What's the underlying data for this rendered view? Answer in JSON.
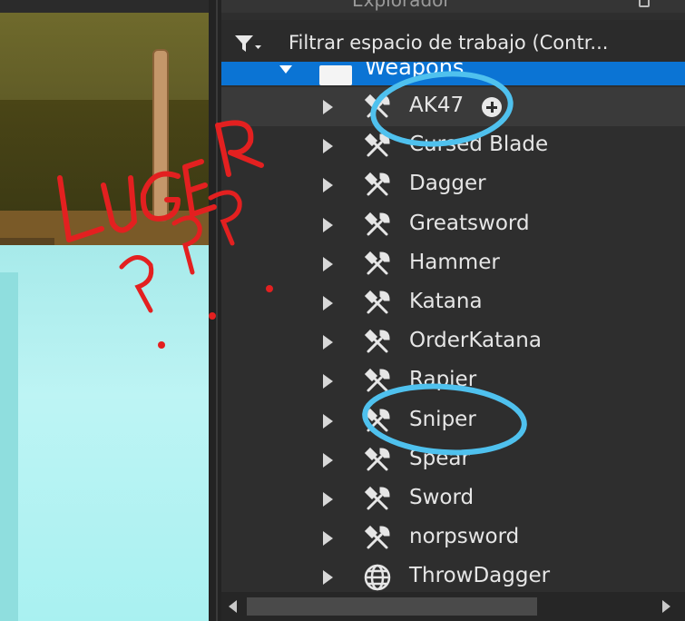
{
  "explorer": {
    "title": "Explorador",
    "filter_placeholder": "Filtrar espacio de trabajo (Contr...",
    "folder": "Weapons",
    "items": [
      {
        "label": "AK47",
        "icon": "tool-icon"
      },
      {
        "label": "Cursed Blade",
        "icon": "tool-icon"
      },
      {
        "label": "Dagger",
        "icon": "tool-icon"
      },
      {
        "label": "Greatsword",
        "icon": "tool-icon"
      },
      {
        "label": "Hammer",
        "icon": "tool-icon"
      },
      {
        "label": "Katana",
        "icon": "tool-icon"
      },
      {
        "label": "OrderKatana",
        "icon": "tool-icon"
      },
      {
        "label": "Rapier",
        "icon": "tool-icon"
      },
      {
        "label": "Sniper",
        "icon": "tool-icon"
      },
      {
        "label": "Spear",
        "icon": "tool-icon"
      },
      {
        "label": "Sword",
        "icon": "tool-icon"
      },
      {
        "label": "norpsword",
        "icon": "tool-icon"
      },
      {
        "label": "ThrowDagger",
        "icon": "globe-icon"
      }
    ]
  },
  "annotation": {
    "text": "LUGER",
    "marks": "??????",
    "color": "#e32020",
    "circle_color": "#4fc1ee"
  }
}
